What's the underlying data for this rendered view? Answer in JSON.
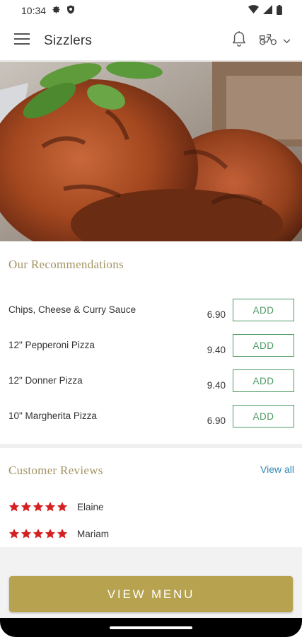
{
  "status_bar": {
    "time": "10:34"
  },
  "app_bar": {
    "title": "Sizzlers"
  },
  "hero": {
    "image_alt": "Tandoori chicken with mint"
  },
  "recommendations": {
    "title": "Our Recommendations",
    "add_label": "ADD",
    "items": [
      {
        "name": "Chips, Cheese & Curry Sauce",
        "price": "6.90"
      },
      {
        "name": "12\" Pepperoni Pizza",
        "price": "9.40"
      },
      {
        "name": "12\" Donner Pizza",
        "price": "9.40"
      },
      {
        "name": "10\" Margherita Pizza",
        "price": "6.90"
      }
    ]
  },
  "reviews": {
    "title": "Customer Reviews",
    "view_all": "View all",
    "items": [
      {
        "name": "Elaine",
        "rating": 5
      },
      {
        "name": "Mariam",
        "rating": 5
      }
    ]
  },
  "footer": {
    "view_menu": "VIEW MENU"
  },
  "colors": {
    "accent": "#b6a24f",
    "section_title": "#a39363",
    "add_green": "#4c9a64",
    "link_blue": "#2f88b5",
    "star_red": "#d42020"
  }
}
